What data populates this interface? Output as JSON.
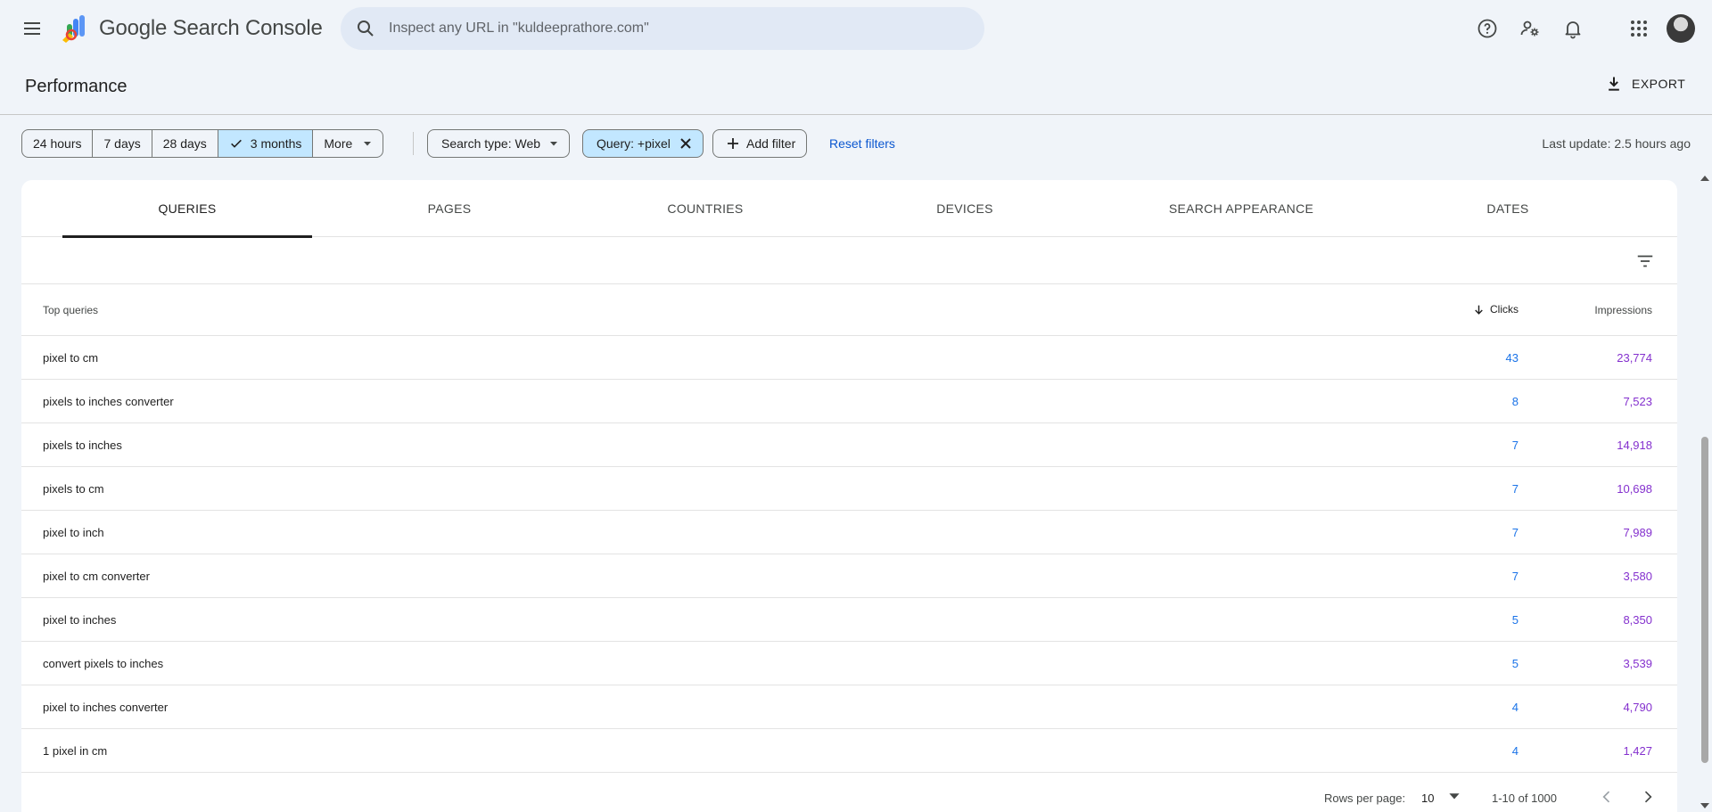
{
  "app": {
    "brand": "Google Search Console",
    "search_placeholder": "Inspect any URL in \"kuldeeprathore.com\""
  },
  "header": {
    "title": "Performance",
    "export_label": "EXPORT"
  },
  "date_ranges": [
    {
      "label": "24 hours",
      "selected": false
    },
    {
      "label": "7 days",
      "selected": false
    },
    {
      "label": "28 days",
      "selected": false
    },
    {
      "label": "3 months",
      "selected": true
    },
    {
      "label": "More",
      "selected": false
    }
  ],
  "filters": {
    "search_type": "Search type: Web",
    "query_filter": "Query: +pixel",
    "add_filter": "Add filter",
    "reset": "Reset filters",
    "last_update": "Last update: 2.5 hours ago"
  },
  "tabs": [
    {
      "label": "QUERIES",
      "active": true
    },
    {
      "label": "PAGES",
      "active": false
    },
    {
      "label": "COUNTRIES",
      "active": false
    },
    {
      "label": "DEVICES",
      "active": false
    },
    {
      "label": "SEARCH APPEARANCE",
      "active": false
    },
    {
      "label": "DATES",
      "active": false
    }
  ],
  "table": {
    "headers": {
      "query": "Top queries",
      "clicks": "Clicks",
      "impressions": "Impressions"
    },
    "sort": "clicks-desc",
    "rows": [
      {
        "query": "pixel to cm",
        "clicks": "43",
        "impressions": "23,774"
      },
      {
        "query": "pixels to inches converter",
        "clicks": "8",
        "impressions": "7,523"
      },
      {
        "query": "pixels to inches",
        "clicks": "7",
        "impressions": "14,918"
      },
      {
        "query": "pixels to cm",
        "clicks": "7",
        "impressions": "10,698"
      },
      {
        "query": "pixel to inch",
        "clicks": "7",
        "impressions": "7,989"
      },
      {
        "query": "pixel to cm converter",
        "clicks": "7",
        "impressions": "3,580"
      },
      {
        "query": "pixel to inches",
        "clicks": "5",
        "impressions": "8,350"
      },
      {
        "query": "convert pixels to inches",
        "clicks": "5",
        "impressions": "3,539"
      },
      {
        "query": "pixel to inches converter",
        "clicks": "4",
        "impressions": "4,790"
      },
      {
        "query": "1 pixel in cm",
        "clicks": "4",
        "impressions": "1,427"
      }
    ]
  },
  "pagination": {
    "rows_per_page_label": "Rows per page:",
    "rows_per_page": "10",
    "range": "1-10 of 1000"
  },
  "colors": {
    "clicks": "#1a73e8",
    "impressions": "#8430ce",
    "selected_chip": "#c2e7ff",
    "search_bg": "#e1e9f5",
    "page_bg": "#f0f4f9"
  }
}
